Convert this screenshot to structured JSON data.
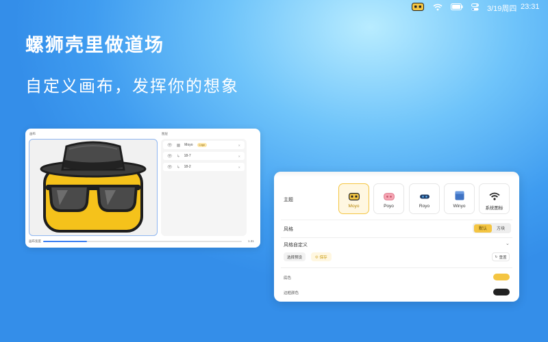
{
  "menubar": {
    "wifi_icon": "wifi-icon",
    "battery_icon": "battery-icon",
    "control_icon": "control-center-icon",
    "date": "3/19周四",
    "time": "23:31"
  },
  "hero": {
    "headline": "螺狮壳里做道场",
    "subline": "自定义画布，发挥你的想象"
  },
  "editor": {
    "canvas_label": "画布",
    "layers_label": "图层",
    "layers": [
      {
        "name": "Moyo",
        "badge": "Logo",
        "icon": "image-icon"
      },
      {
        "name": "18-7",
        "badge": "",
        "icon": "path-icon"
      },
      {
        "name": "18-2",
        "badge": "",
        "icon": "path-icon"
      }
    ],
    "zoom_label": "画布宽度",
    "zoom_value": "1.31",
    "zoom_progress": 0.22
  },
  "settings": {
    "theme_label": "主题",
    "themes": [
      {
        "name": "Moyo",
        "selected": true,
        "color": "#f4c542"
      },
      {
        "name": "Poyo",
        "selected": false,
        "color": "#f6a5b3"
      },
      {
        "name": "Royo",
        "selected": false,
        "color": "#1f3c66"
      },
      {
        "name": "Winyo",
        "selected": false,
        "color": "#3f73c4"
      },
      {
        "name": "系统图标",
        "selected": false,
        "color": "#222222"
      }
    ],
    "style_label": "风格",
    "style_options": [
      "默认",
      "方块"
    ],
    "style_selected": "默认",
    "custom_label": "风格自定义",
    "preset_button": "选择预设",
    "save_button": "保存",
    "reset_button": "重置",
    "bg_color_label": "底色",
    "bg_color": "#f4c542",
    "border_color_label": "边框颜色",
    "border_color": "#222222"
  }
}
